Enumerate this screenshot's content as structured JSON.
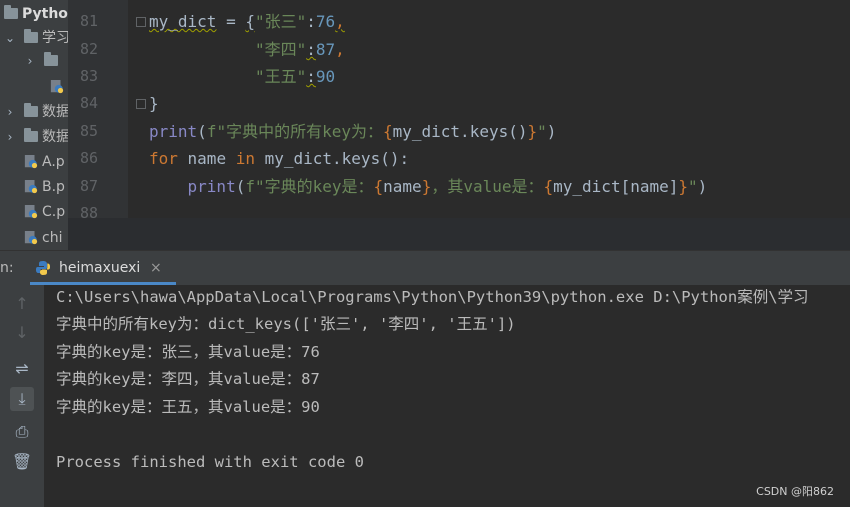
{
  "project_tree": {
    "items": [
      {
        "label": "Pytho",
        "indent": 0,
        "arrow": "",
        "type": "folder"
      },
      {
        "label": "学习",
        "indent": 1,
        "arrow": "⌄",
        "type": "folder"
      },
      {
        "label": "",
        "indent": 2,
        "arrow": "›",
        "type": "folder"
      },
      {
        "label": "",
        "indent": 3,
        "arrow": "",
        "type": "py"
      },
      {
        "label": "数据",
        "indent": 1,
        "arrow": "›",
        "type": "folder"
      },
      {
        "label": "数据",
        "indent": 1,
        "arrow": "›",
        "type": "folder"
      },
      {
        "label": "A.p",
        "indent": 1,
        "arrow": "",
        "type": "py"
      },
      {
        "label": "B.p",
        "indent": 1,
        "arrow": "",
        "type": "py"
      },
      {
        "label": "C.p",
        "indent": 1,
        "arrow": "",
        "type": "py"
      },
      {
        "label": "chi",
        "indent": 1,
        "arrow": "",
        "type": "py"
      }
    ]
  },
  "editor": {
    "line_numbers": [
      "81",
      "82",
      "83",
      "84",
      "85",
      "86",
      "87",
      "88"
    ],
    "lines": [
      [
        {
          "t": "my_dict",
          "c": "squig"
        },
        {
          "t": " = ",
          "c": ""
        },
        {
          "t": "{",
          "c": "squig"
        },
        {
          "t": "\"张三\"",
          "c": "str"
        },
        {
          "t": ":",
          "c": ""
        },
        {
          "t": "76",
          "c": "num"
        },
        {
          "t": ",",
          "c": "kw squig"
        }
      ],
      [
        {
          "t": "           ",
          "c": ""
        },
        {
          "t": "\"李四\"",
          "c": "str"
        },
        {
          "t": ":",
          "c": "squig"
        },
        {
          "t": "87",
          "c": "num"
        },
        {
          "t": ",",
          "c": "kw"
        }
      ],
      [
        {
          "t": "           ",
          "c": ""
        },
        {
          "t": "\"王五\"",
          "c": "str"
        },
        {
          "t": ":",
          "c": "squig"
        },
        {
          "t": "90",
          "c": "num"
        }
      ],
      [
        {
          "t": "}",
          "c": ""
        }
      ],
      [
        {
          "t": "print",
          "c": "fn"
        },
        {
          "t": "(",
          "c": ""
        },
        {
          "t": "f\"字典中的所有key为：",
          "c": "str"
        },
        {
          "t": "{",
          "c": "brace"
        },
        {
          "t": "my_dict.keys()",
          "c": ""
        },
        {
          "t": "}",
          "c": "brace"
        },
        {
          "t": "\"",
          "c": "str"
        },
        {
          "t": ")",
          "c": ""
        }
      ],
      [
        {
          "t": "for",
          "c": "kw"
        },
        {
          "t": " name ",
          "c": ""
        },
        {
          "t": "in",
          "c": "kw"
        },
        {
          "t": " my_dict.keys():",
          "c": ""
        }
      ],
      [
        {
          "t": "    ",
          "c": ""
        },
        {
          "t": "print",
          "c": "fn"
        },
        {
          "t": "(",
          "c": ""
        },
        {
          "t": "f\"字典的key是：",
          "c": "str"
        },
        {
          "t": "{",
          "c": "brace"
        },
        {
          "t": "name",
          "c": ""
        },
        {
          "t": "}",
          "c": "brace"
        },
        {
          "t": "，其value是：",
          "c": "str"
        },
        {
          "t": "{",
          "c": "brace"
        },
        {
          "t": "my_dict[name]",
          "c": ""
        },
        {
          "t": "}",
          "c": "brace"
        },
        {
          "t": "\"",
          "c": "str"
        },
        {
          "t": ")",
          "c": ""
        }
      ],
      []
    ]
  },
  "run_panel": {
    "label": "n:",
    "tab_label": "heimaxuexi",
    "tab_close": "×",
    "tools": [
      {
        "icon": "arrow-up-icon",
        "glyph": "↑",
        "dim": true
      },
      {
        "icon": "arrow-down-icon",
        "glyph": "↓",
        "dim": true
      },
      {
        "icon": "soft-wrap-icon",
        "glyph": "⇌",
        "dim": false
      },
      {
        "icon": "scroll-to-end-icon",
        "glyph": "⤓",
        "dim": false,
        "active": true
      },
      {
        "icon": "print-icon",
        "glyph": "⎙",
        "dim": false
      },
      {
        "icon": "trash-icon",
        "glyph": "🗑",
        "dim": false
      }
    ],
    "output": [
      "C:\\Users\\hawa\\AppData\\Local\\Programs\\Python\\Python39\\python.exe D:\\Python案例\\学习",
      "字典中的所有key为：dict_keys(['张三', '李四', '王五'])",
      "字典的key是：张三，其value是：76",
      "字典的key是：李四，其value是：87",
      "字典的key是：王五，其value是：90",
      "",
      "Process finished with exit code 0"
    ]
  },
  "watermark": "CSDN @阳862",
  "colors": {
    "keyword": "#cc7832",
    "string": "#6a8759",
    "number": "#6897bb",
    "builtin": "#8888c6",
    "accent": "#4a88c7"
  }
}
